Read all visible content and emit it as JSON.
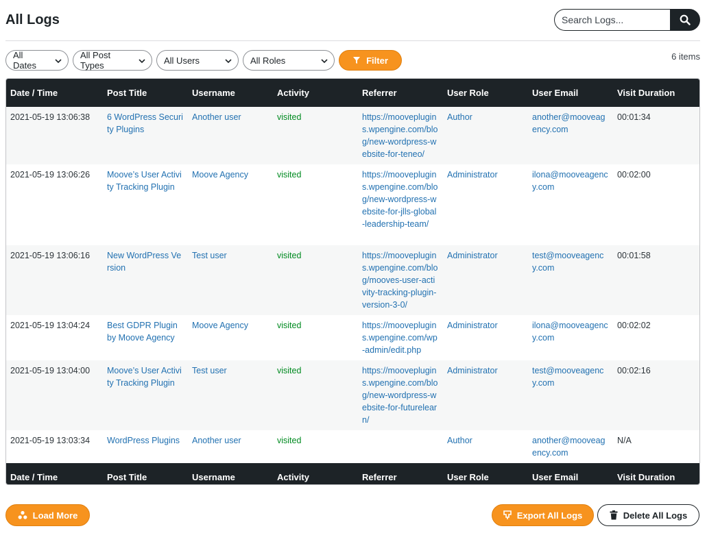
{
  "page": {
    "title": "All Logs"
  },
  "search": {
    "placeholder": "Search Logs...",
    "icon": "search-icon"
  },
  "filters": {
    "dates": "All Dates",
    "post_types": "All Post Types",
    "users": "All Users",
    "roles": "All Roles",
    "filter_label": "Filter"
  },
  "items_count": "6 items",
  "table": {
    "headers": [
      "Date / Time",
      "Post Title",
      "Username",
      "Activity",
      "Referrer",
      "User Role",
      "User Email",
      "Visit Duration"
    ],
    "rows": [
      {
        "datetime": "2021-05-19 13:06:38",
        "post_title": "6 WordPress Security Plugins",
        "username": "Another user",
        "activity": "visited",
        "referrer": "https://mooveplugins.wpengine.com/blog/new-wordpress-website-for-teneo/",
        "role": "Author",
        "email": "another@mooveagency.com",
        "duration": "00:01:34"
      },
      {
        "datetime": "2021-05-19 13:06:26",
        "post_title": "Moove’s User Activity Tracking Plugin",
        "username": "Moove Agency",
        "activity": "visited",
        "referrer": "https://mooveplugins.wpengine.com/blog/new-wordpress-website-for-jlls-global-leadership-team/",
        "role": "Administrator",
        "email": "ilona@mooveagency.com",
        "duration": "00:02:00"
      },
      {
        "datetime": "2021-05-19 13:06:16",
        "post_title": "New WordPress Version",
        "username": "Test user",
        "activity": "visited",
        "referrer": "https://mooveplugins.wpengine.com/blog/mooves-user-activity-tracking-plugin-version-3-0/",
        "role": "Administrator",
        "email": "test@mooveagency.com",
        "duration": "00:01:58"
      },
      {
        "datetime": "2021-05-19 13:04:24",
        "post_title": "Best GDPR Plugin by Moove Agency",
        "username": "Moove Agency",
        "activity": "visited",
        "referrer": "https://mooveplugins.wpengine.com/wp-admin/edit.php",
        "role": "Administrator",
        "email": "ilona@mooveagency.com",
        "duration": "00:02:02"
      },
      {
        "datetime": "2021-05-19 13:04:00",
        "post_title": "Moove’s User Activity Tracking Plugin",
        "username": "Test user",
        "activity": "visited",
        "referrer": "https://mooveplugins.wpengine.com/blog/new-wordpress-website-for-futurelearn/",
        "role": "Administrator",
        "email": "test@mooveagency.com",
        "duration": "00:02:16"
      },
      {
        "datetime": "2021-05-19 13:03:34",
        "post_title": "WordPress Plugins",
        "username": "Another user",
        "activity": "visited",
        "referrer": "",
        "role": "Author",
        "email": "another@mooveagency.com",
        "duration": "N/A"
      }
    ]
  },
  "actions": {
    "load_more": "Load More",
    "export_all": "Export All Logs",
    "delete_all": "Delete All Logs"
  },
  "colors": {
    "accent": "#f7931e",
    "header_bg": "#1d2327",
    "link": "#2271b1",
    "activity": "#008a20"
  }
}
